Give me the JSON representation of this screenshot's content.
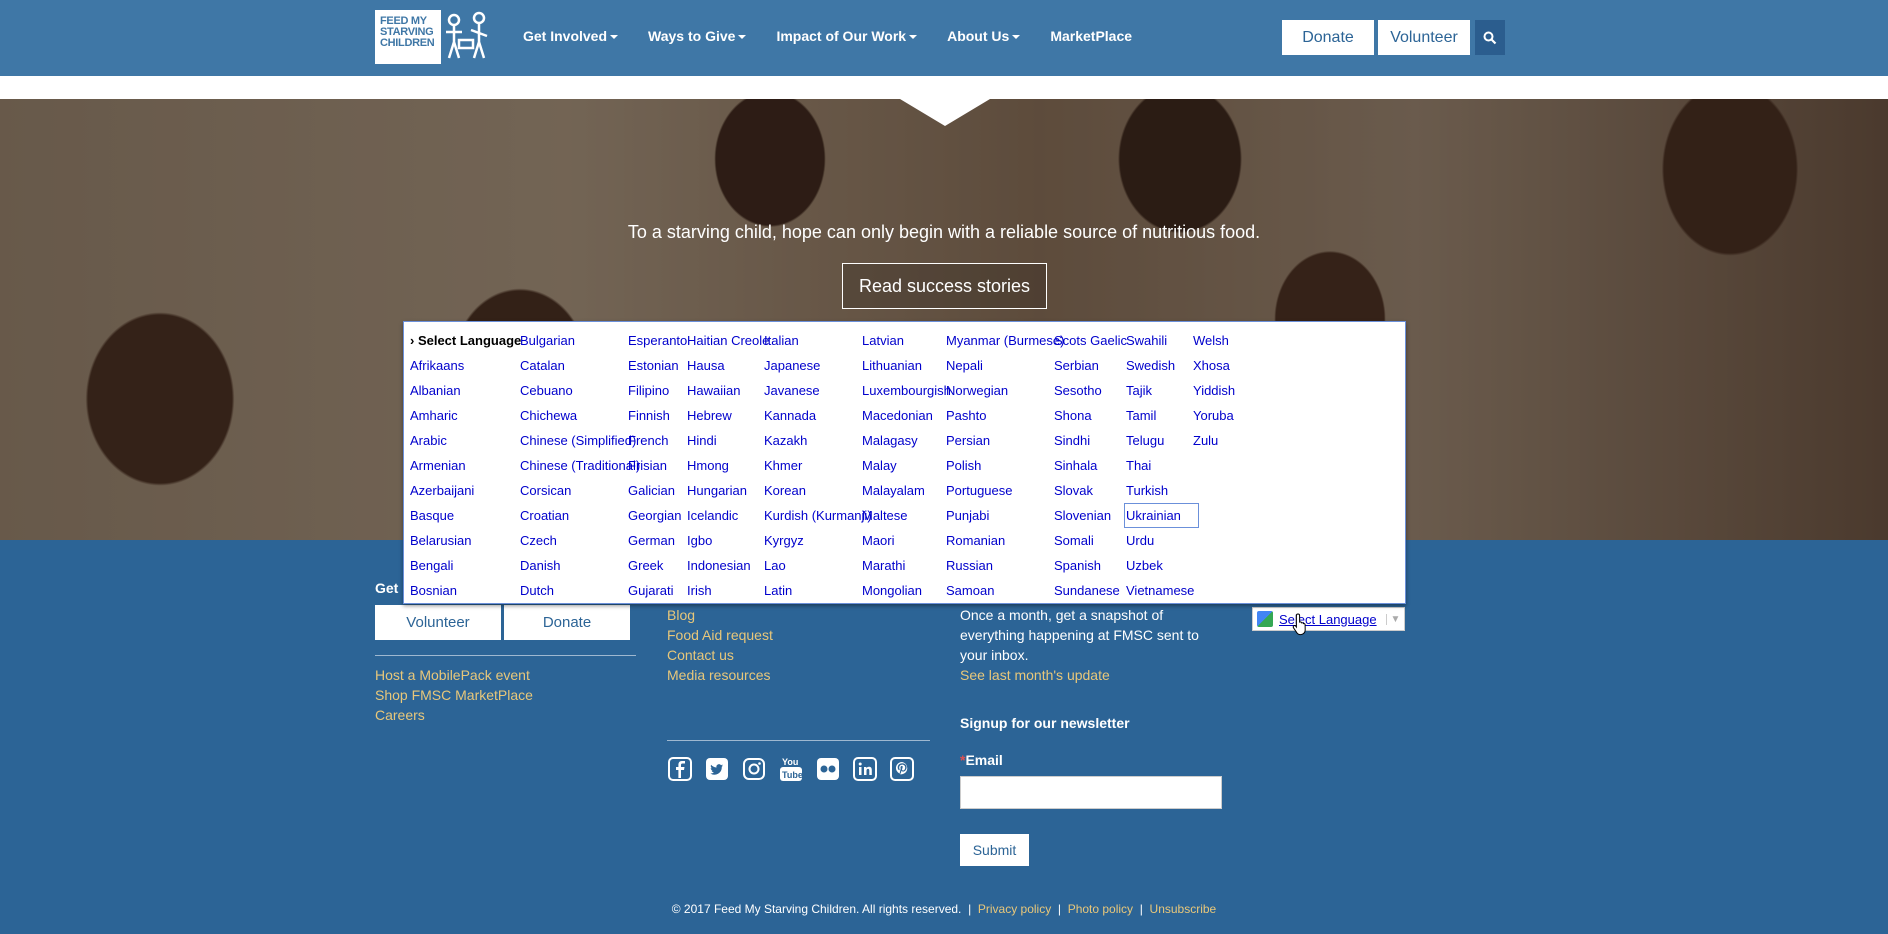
{
  "header": {
    "logo_text": "FEED MY STARVING CHILDREN",
    "nav": [
      {
        "label": "Get Involved",
        "dropdown": true
      },
      {
        "label": "Ways to Give",
        "dropdown": true
      },
      {
        "label": "Impact of Our Work",
        "dropdown": true
      },
      {
        "label": "About Us",
        "dropdown": true
      },
      {
        "label": "MarketPlace",
        "dropdown": false
      }
    ],
    "donate_label": "Donate",
    "volunteer_label": "Volunteer"
  },
  "hero": {
    "tagline": "To a starving child, hope can only begin with a reliable source of nutritious food.",
    "cta_label": "Read success stories"
  },
  "language_menu": {
    "selected": "› Select Language",
    "focused": "Ukrainian",
    "columns": [
      [
        "› Select Language",
        "Afrikaans",
        "Albanian",
        "Amharic",
        "Arabic",
        "Armenian",
        "Azerbaijani",
        "Basque",
        "Belarusian",
        "Bengali",
        "Bosnian"
      ],
      [
        "Bulgarian",
        "Catalan",
        "Cebuano",
        "Chichewa",
        "Chinese (Simplified)",
        "Chinese (Traditional)",
        "Corsican",
        "Croatian",
        "Czech",
        "Danish",
        "Dutch"
      ],
      [
        "Esperanto",
        "Estonian",
        "Filipino",
        "Finnish",
        "French",
        "Frisian",
        "Galician",
        "Georgian",
        "German",
        "Greek",
        "Gujarati"
      ],
      [
        "Haitian Creole",
        "Hausa",
        "Hawaiian",
        "Hebrew",
        "Hindi",
        "Hmong",
        "Hungarian",
        "Icelandic",
        "Igbo",
        "Indonesian",
        "Irish"
      ],
      [
        "Italian",
        "Japanese",
        "Javanese",
        "Kannada",
        "Kazakh",
        "Khmer",
        "Korean",
        "Kurdish (Kurmanji)",
        "Kyrgyz",
        "Lao",
        "Latin"
      ],
      [
        "Latvian",
        "Lithuanian",
        "Luxembourgish",
        "Macedonian",
        "Malagasy",
        "Malay",
        "Malayalam",
        "Maltese",
        "Maori",
        "Marathi",
        "Mongolian"
      ],
      [
        "Myanmar (Burmese)",
        "Nepali",
        "Norwegian",
        "Pashto",
        "Persian",
        "Polish",
        "Portuguese",
        "Punjabi",
        "Romanian",
        "Russian",
        "Samoan"
      ],
      [
        "Scots Gaelic",
        "Serbian",
        "Sesotho",
        "Shona",
        "Sindhi",
        "Sinhala",
        "Slovak",
        "Slovenian",
        "Somali",
        "Spanish",
        "Sundanese"
      ],
      [
        "Swahili",
        "Swedish",
        "Tajik",
        "Tamil",
        "Telugu",
        "Thai",
        "Turkish",
        "Ukrainian",
        "Urdu",
        "Uzbek",
        "Vietnamese"
      ],
      [
        "Welsh",
        "Xhosa",
        "Yiddish",
        "Yoruba",
        "Zulu"
      ]
    ]
  },
  "footer": {
    "col1_heading_partial": "Get",
    "volunteer_label": "Volunteer",
    "donate_label": "Donate",
    "links_col1": [
      "Host a MobilePack event",
      "Shop FMSC MarketPlace",
      "Careers"
    ],
    "links_col2": [
      "Blog",
      "Food Aid request",
      "Contact us",
      "Media resources"
    ],
    "newsletter_text": [
      "Once a month, get a snapshot of",
      "everything happening at FMSC sent to",
      "your inbox."
    ],
    "last_update_link": "See last month's update",
    "signup_heading": "Signup for our newsletter",
    "email_required_mark": "*",
    "email_label": "Email",
    "submit_label": "Submit",
    "google_translate_label": "Select Language",
    "copyright": "© 2017  Feed My Starving Children. All rights reserved.",
    "legal_links": [
      "Privacy policy",
      "Photo policy",
      "Unsubscribe"
    ],
    "separator": "|"
  },
  "social_icons": [
    "facebook-icon",
    "twitter-icon",
    "instagram-icon",
    "youtube-icon",
    "flickr-icon",
    "linkedin-icon",
    "pinterest-icon"
  ]
}
